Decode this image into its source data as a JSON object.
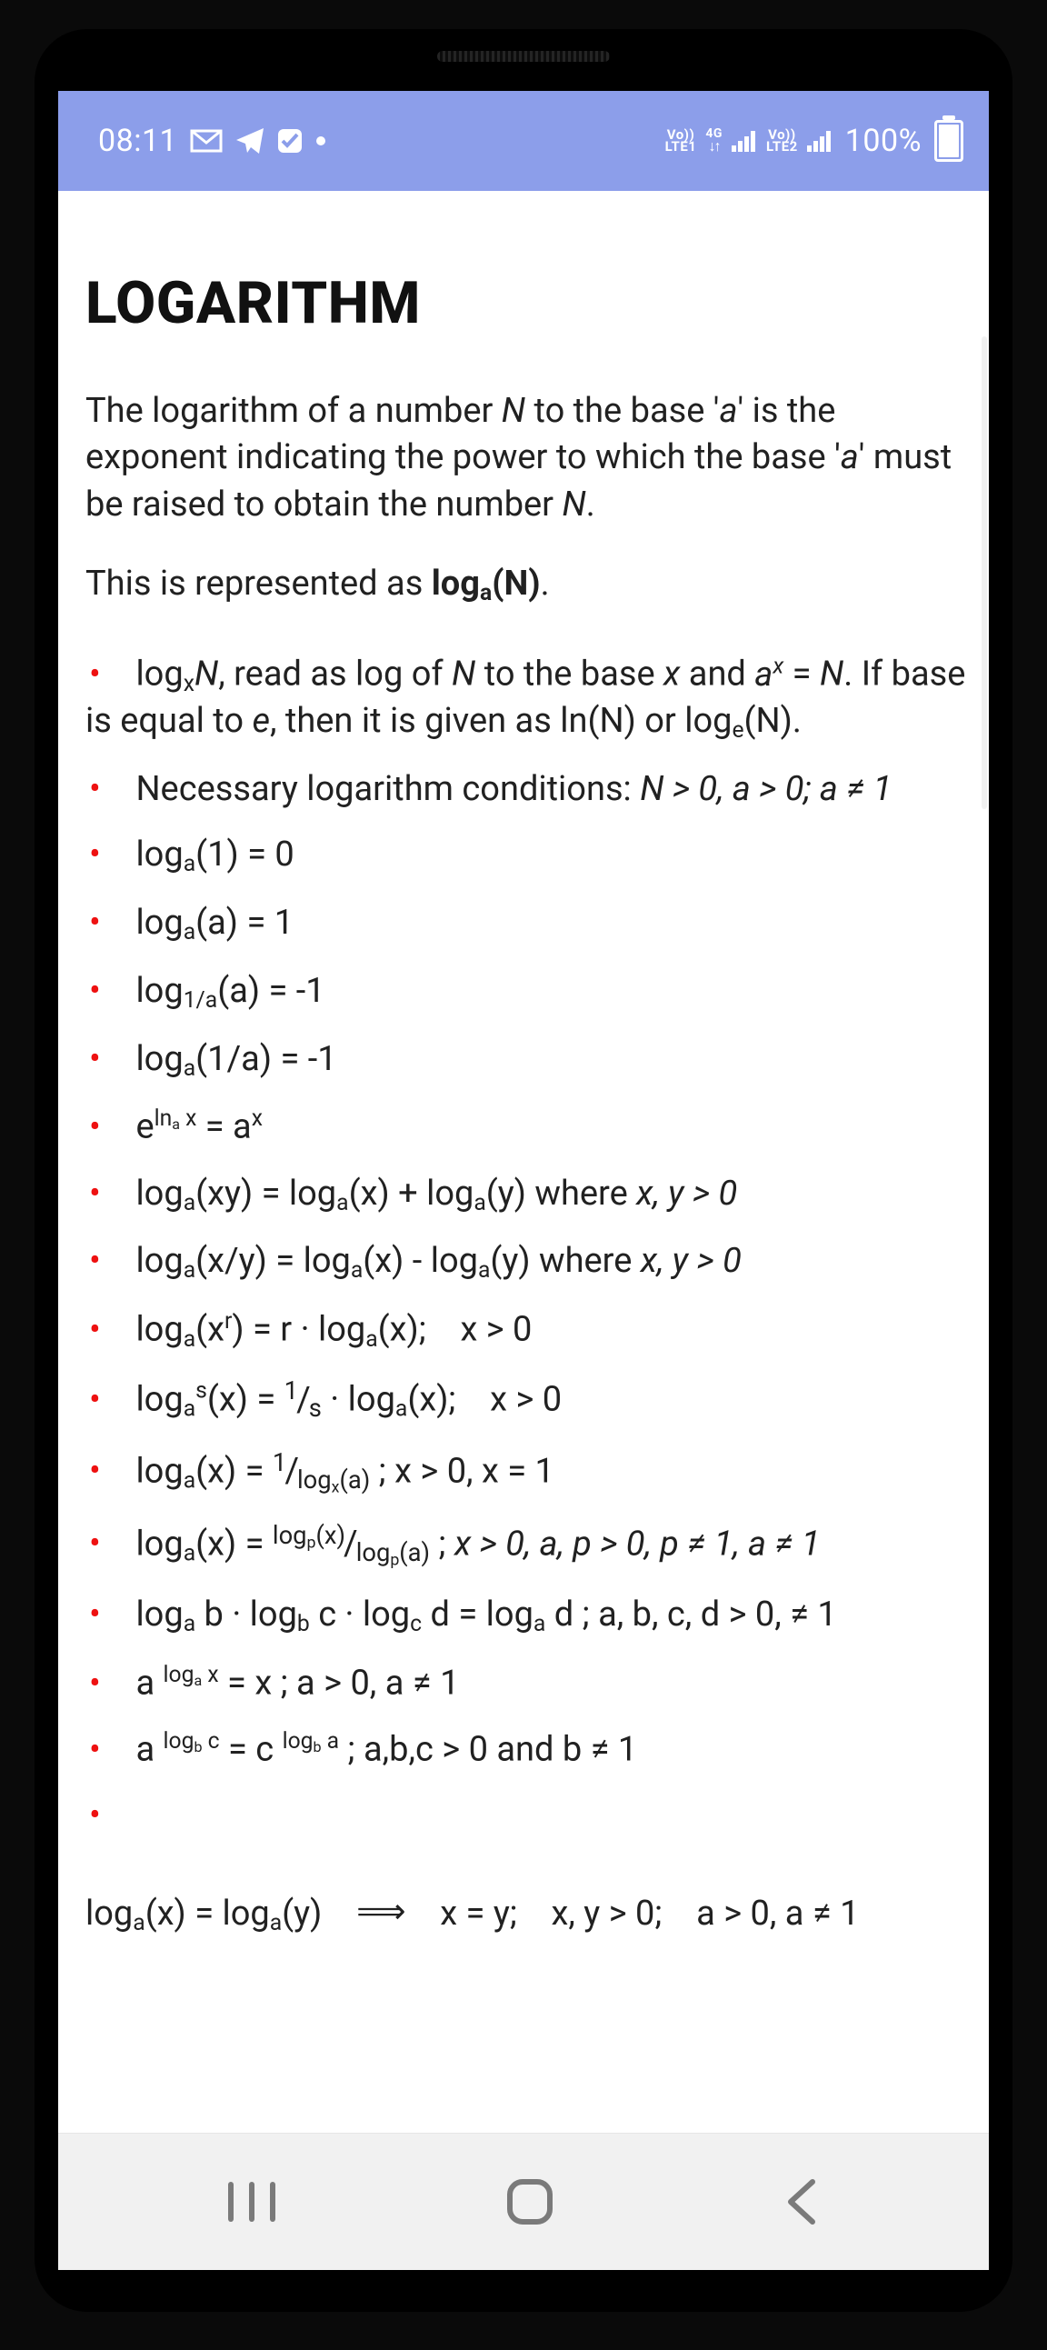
{
  "status": {
    "time": "08:11",
    "icons": [
      "gmail",
      "telegram",
      "checkbox",
      "dot"
    ],
    "lte1_top": "Vo))",
    "lte1_bot": "LTE1",
    "updn_top": "4G",
    "updn_bot": "↓↑",
    "signal1_bars": 4,
    "lte2_top": "Vo))",
    "lte2_bot": "LTE2",
    "signal2_bars": 4,
    "battery_pct": "100%"
  },
  "doc": {
    "title": "LOGARITHM",
    "p1_a": "The logarithm of a number ",
    "p1_N": "N",
    "p1_b": " to the base '",
    "p1_a1": "a",
    "p1_c": "' is the exponent indicating the power to which the base '",
    "p1_a2": "a",
    "p1_d": "' must be raised to obtain the number ",
    "p1_N2": "N",
    "p1_e": ".",
    "p2_a": "This is represented as ",
    "p2_b": "log",
    "p2_sub": "a",
    "p2_c": "(N)",
    "p2_d": ".",
    "li1_a": "log",
    "li1_sub": "x",
    "li1_N": "N",
    "li1_b": ", read as log of ",
    "li1_N2": "N",
    "li1_c": " to the base ",
    "li1_x": "x",
    "li1_d": " and ",
    "li1_ax_base": "a",
    "li1_ax_sup": "x",
    "li1_e": " = ",
    "li1_N3": "N",
    "li1_f": ". If base is equal to ",
    "li1_ebase": "e",
    "li1_g": ", then it is given as ln(N) or log",
    "li1_esub": "e",
    "li1_h": "(N).",
    "li2_a": "Necessary logarithm conditions: ",
    "li2_b": "N > 0, a > 0; a ≠ 1",
    "li3": "log",
    "li3_sub": "a",
    "li3_b": "(1) = 0",
    "li4": "log",
    "li4_sub": "a",
    "li4_b": "(a) = 1",
    "li5": "log",
    "li5_sub": "1/a",
    "li5_b": "(a) = -1",
    "li6": "log",
    "li6_sub": "a",
    "li6_b": "(1/a) = -1",
    "li7_e": "e",
    "li7_sup1": "ln",
    "li7_supsub": "a",
    "li7_sup2": " x",
    "li7_eq": " = a",
    "li7_sup3": "x",
    "li8_a": "log",
    "li8_sub1": "a",
    "li8_b": "(xy) = log",
    "li8_sub2": "a",
    "li8_c": "(x) + log",
    "li8_sub3": "a",
    "li8_d": "(y) where ",
    "li8_e": "x, y > 0",
    "li9_a": "log",
    "li9_sub1": "a",
    "li9_b": "(x/y) = log",
    "li9_sub2": "a",
    "li9_c": "(x) - log",
    "li9_sub3": "a",
    "li9_d": "(y) where ",
    "li9_e": "x, y > 0",
    "li10_a": "log",
    "li10_sub": "a",
    "li10_b": "(x",
    "li10_sup": "r",
    "li10_c": ") = r · log",
    "li10_sub2": "a",
    "li10_d": "(x);    x > 0",
    "li11_a": "log",
    "li11_sub": "a",
    "li11_sup": "s",
    "li11_b": "(x) = ",
    "li11_ft": "1",
    "li11_fb": "s",
    "li11_c": " · log",
    "li11_sub2": "a",
    "li11_d": "(x);    x > 0",
    "li12_a": "log",
    "li12_sub": "a",
    "li12_b": "(x) = ",
    "li12_ft": "1",
    "li12_fb_a": "log",
    "li12_fb_sub": "x",
    "li12_fb_b": "(a)",
    "li12_c": " ; x > 0, x = 1",
    "li13_a": "log",
    "li13_sub": "a",
    "li13_b": "(x) = ",
    "li13_ft_a": "log",
    "li13_ft_sub": "p",
    "li13_ft_b": "(x)",
    "li13_fb_a": "log",
    "li13_fb_sub": "p",
    "li13_fb_b": "(a)",
    "li13_c": " ; ",
    "li13_d": "x > 0, a, p > 0, p ≠ 1, a ≠ 1",
    "li14_a": "log",
    "li14_s1": "a",
    "li14_b": " b · log",
    "li14_s2": "b",
    "li14_c": " c · log",
    "li14_s3": "c",
    "li14_d": " d = log",
    "li14_s4": "a",
    "li14_e": " d ; a, b, c, d > 0, ≠ 1",
    "li15_a": "a ",
    "li15_sup_a": "log",
    "li15_sup_sub": "a",
    "li15_sup_b": " x",
    "li15_b": " = x ; a > 0, a ≠ 1",
    "li16_a": "a ",
    "li16_sup1_a": "log",
    "li16_sup1_sub": "b",
    "li16_sup1_b": " c",
    "li16_b": " = c ",
    "li16_sup2_a": "log",
    "li16_sup2_sub": "b",
    "li16_sup2_b": " a",
    "li16_c": " ; a,b,c > 0 and b ≠ 1",
    "last_a": "log",
    "last_sub1": "a",
    "last_b": "(x) = log",
    "last_sub2": "a",
    "last_c": "(y)    ",
    "last_imp": "⟹",
    "last_d": "    x = y;    x, y > 0;    a > 0, a ≠ 1"
  }
}
